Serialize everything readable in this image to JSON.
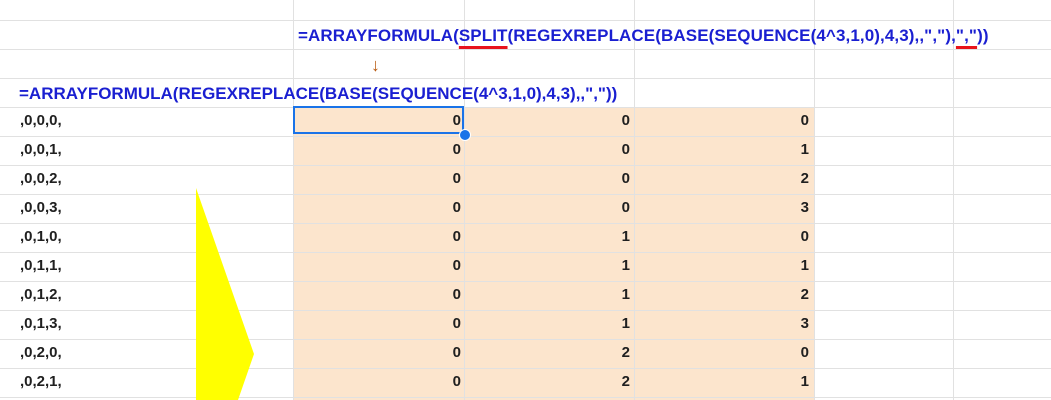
{
  "colors": {
    "formula_text": "#1a1fd1",
    "highlight_fill": "#fce5cd",
    "selection_border": "#1a73e8",
    "underline": "#e8131b",
    "arrow_fill": "#ffff00"
  },
  "formula_top": {
    "prefix": "=ARRAYFORMULA(",
    "split": "SPLIT",
    "middle": "(REGEXREPLACE(BASE(SEQUENCE(4^3,1,0),4,3),,\",\"),",
    "delimiter": "\",\"",
    "suffix": "))"
  },
  "arrow_glyph": "↓",
  "formula_main": "=ARRAYFORMULA(REGEXREPLACE(BASE(SEQUENCE(4^3,1,0),4,3),,\",\"))",
  "rows": [
    {
      "a": ",0,0,0,",
      "c1": "0",
      "c2": "0",
      "c3": "0"
    },
    {
      "a": ",0,0,1,",
      "c1": "0",
      "c2": "0",
      "c3": "1"
    },
    {
      "a": ",0,0,2,",
      "c1": "0",
      "c2": "0",
      "c3": "2"
    },
    {
      "a": ",0,0,3,",
      "c1": "0",
      "c2": "0",
      "c3": "3"
    },
    {
      "a": ",0,1,0,",
      "c1": "0",
      "c2": "1",
      "c3": "0"
    },
    {
      "a": ",0,1,1,",
      "c1": "0",
      "c2": "1",
      "c3": "1"
    },
    {
      "a": ",0,1,2,",
      "c1": "0",
      "c2": "1",
      "c3": "2"
    },
    {
      "a": ",0,1,3,",
      "c1": "0",
      "c2": "1",
      "c3": "3"
    },
    {
      "a": ",0,2,0,",
      "c1": "0",
      "c2": "2",
      "c3": "0"
    },
    {
      "a": ",0,2,1,",
      "c1": "0",
      "c2": "2",
      "c3": "1"
    }
  ]
}
